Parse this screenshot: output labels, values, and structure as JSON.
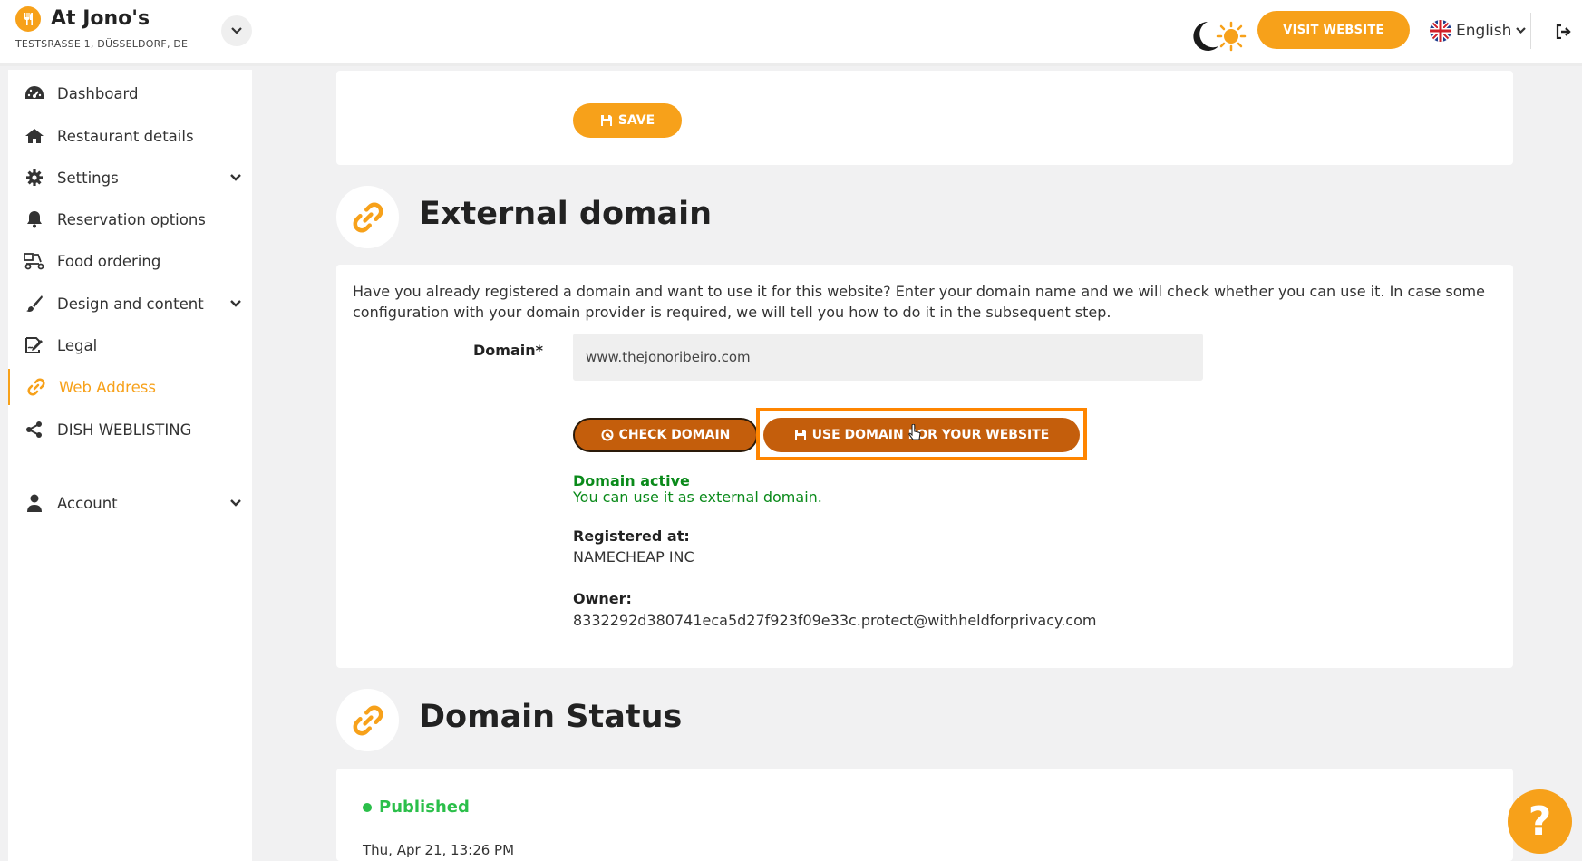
{
  "header": {
    "brand_name": "At Jono's",
    "brand_address": "TESTSRASSE 1, DÜSSELDORF, DE",
    "visit_label": "VISIT WEBSITE",
    "language": "English"
  },
  "sidebar": {
    "items": [
      {
        "label": "Dashboard",
        "icon": "dashboard-icon"
      },
      {
        "label": "Restaurant details",
        "icon": "home-icon"
      },
      {
        "label": "Settings",
        "icon": "gear-icon",
        "expandable": true
      },
      {
        "label": "Reservation options",
        "icon": "bell-icon"
      },
      {
        "label": "Food ordering",
        "icon": "scooter-icon"
      },
      {
        "label": "Design and content",
        "icon": "brush-icon",
        "expandable": true
      },
      {
        "label": "Legal",
        "icon": "signature-icon"
      },
      {
        "label": "Web Address",
        "icon": "link-icon",
        "active": true
      },
      {
        "label": "DISH WEBLISTING",
        "icon": "share-icon"
      },
      {
        "label": "Account",
        "icon": "user-icon",
        "expandable": true
      }
    ]
  },
  "save_card": {
    "save_label": "SAVE"
  },
  "external_domain": {
    "title": "External domain",
    "intro": "Have you already registered a domain and want to use it for this website? Enter your domain name and we will check whether you can use it. In case some configuration with your domain provider is required, we will tell you how to do it in the subsequent step.",
    "domain_label": "Domain*",
    "domain_value": "www.thejonoribeiro.com",
    "check_label": "CHECK DOMAIN",
    "use_label": "USE DOMAIN FOR YOUR WEBSITE",
    "status_title": "Domain active",
    "status_desc": "You can use it as external domain.",
    "registered_label": "Registered at:",
    "registered_value": "NAMECHEAP INC",
    "owner_label": "Owner:",
    "owner_value": "8332292d380741eca5d27f923f09e33c.protect@withheldforprivacy.com"
  },
  "domain_status": {
    "title": "Domain Status",
    "status": "Published",
    "date": "Thu, Apr 21, 13:26 PM"
  },
  "help_label": "?",
  "colors": {
    "accent": "#f7a11a",
    "button_dark": "#c45e0c",
    "highlight": "#ff8500",
    "success": "#0a8a1a",
    "published": "#2bbf4a"
  }
}
